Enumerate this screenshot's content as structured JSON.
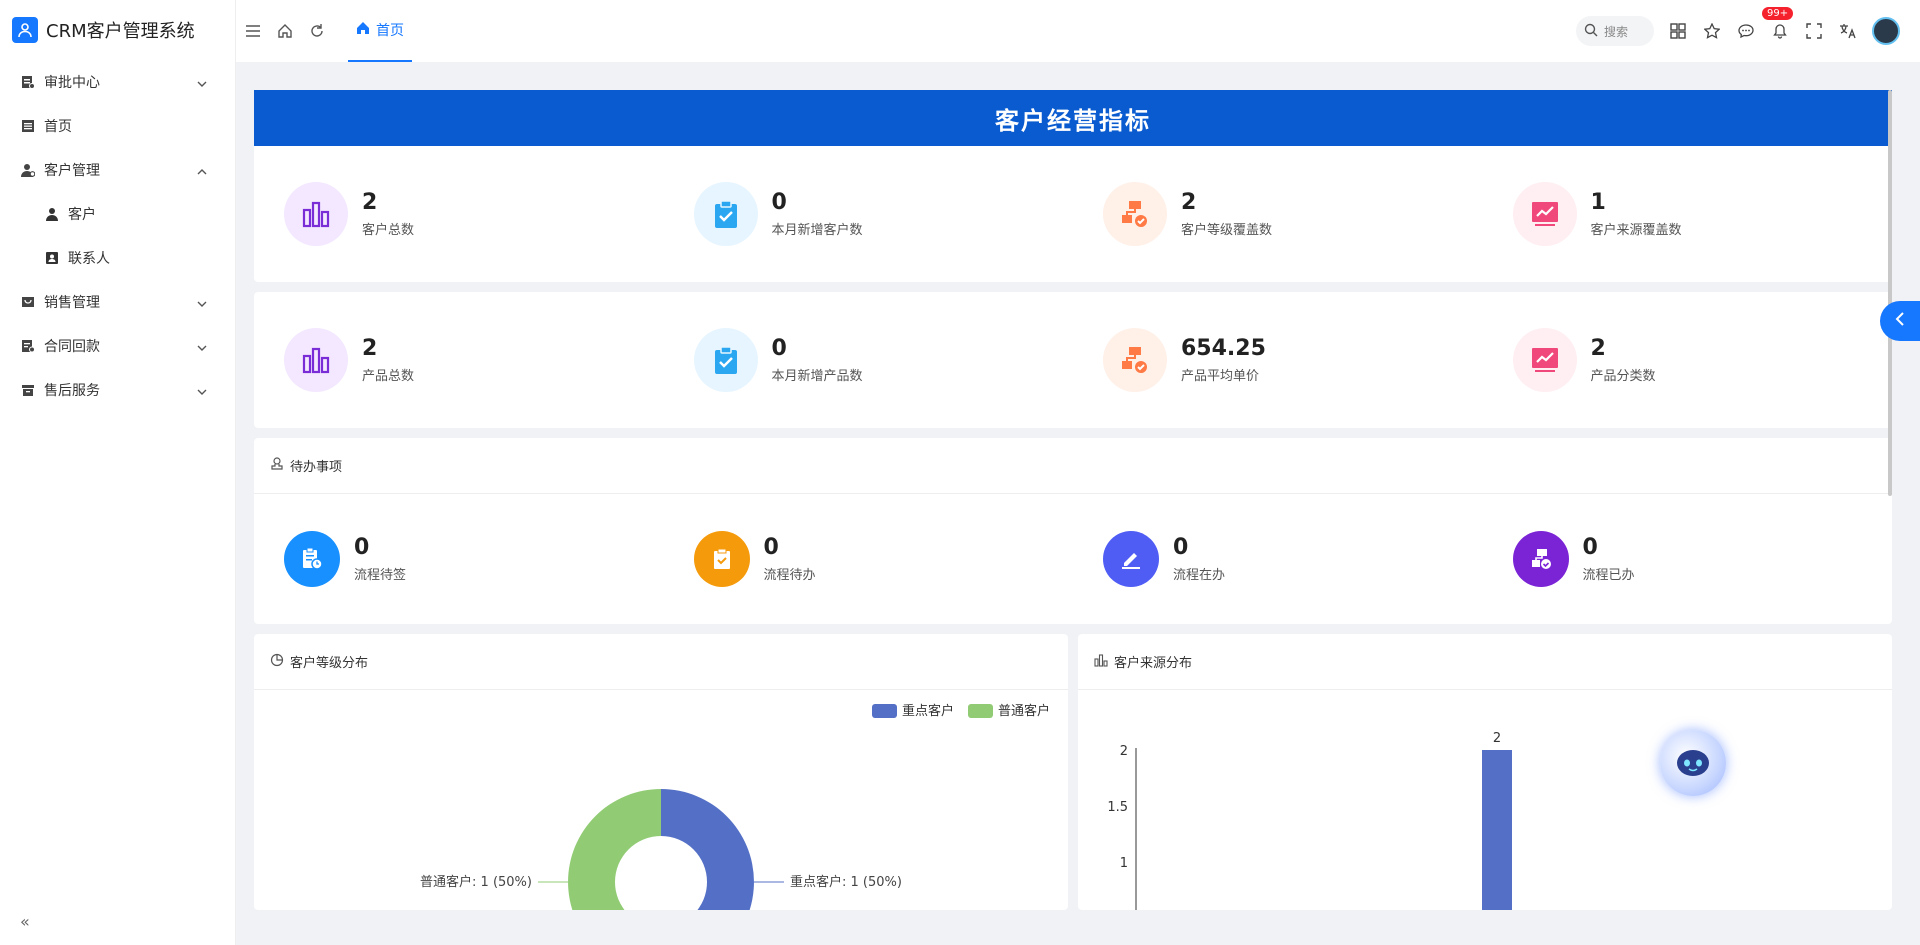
{
  "app": {
    "title": "CRM客户管理系统"
  },
  "sidebar": {
    "items": [
      {
        "label": "审批中心",
        "expandable": true,
        "expanded": false,
        "icon": "approval-icon"
      },
      {
        "label": "首页",
        "expandable": false,
        "icon": "home-doc-icon"
      },
      {
        "label": "客户管理",
        "expandable": true,
        "expanded": true,
        "icon": "customer-mgmt-icon"
      },
      {
        "label": "客户",
        "sub": true,
        "icon": "user-icon"
      },
      {
        "label": "联系人",
        "sub": true,
        "icon": "contact-icon"
      },
      {
        "label": "销售管理",
        "expandable": true,
        "expanded": false,
        "icon": "sales-icon"
      },
      {
        "label": "合同回款",
        "expandable": true,
        "expanded": false,
        "icon": "contract-icon"
      },
      {
        "label": "售后服务",
        "expandable": true,
        "expanded": false,
        "icon": "service-icon"
      }
    ]
  },
  "header": {
    "tab_home": "首页",
    "search_placeholder": "搜索",
    "notification_badge": "99+"
  },
  "banner": {
    "title": "客户经营指标"
  },
  "customer_stats": [
    {
      "value": "2",
      "label": "客户总数",
      "icon": "bar-chart-icon",
      "bg": "#f3e8ff",
      "fg": "#7a2cd6"
    },
    {
      "value": "0",
      "label": "本月新增客户数",
      "icon": "clipboard-check-icon",
      "bg": "#e6f5ff",
      "fg": "#2aa7f0"
    },
    {
      "value": "2",
      "label": "客户等级覆盖数",
      "icon": "flow-check-icon",
      "bg": "#fff0e8",
      "fg": "#ff7a45"
    },
    {
      "value": "1",
      "label": "客户来源覆盖数",
      "icon": "trend-monitor-icon",
      "bg": "#ffeef2",
      "fg": "#f0487a"
    }
  ],
  "product_stats": [
    {
      "value": "2",
      "label": "产品总数",
      "icon": "bar-chart-icon",
      "bg": "#f3e8ff",
      "fg": "#7a2cd6"
    },
    {
      "value": "0",
      "label": "本月新增产品数",
      "icon": "clipboard-check-icon",
      "bg": "#e6f5ff",
      "fg": "#2aa7f0"
    },
    {
      "value": "654.25",
      "label": "产品平均单价",
      "icon": "flow-check-icon",
      "bg": "#fff0e8",
      "fg": "#ff7a45"
    },
    {
      "value": "2",
      "label": "产品分类数",
      "icon": "trend-monitor-icon",
      "bg": "#ffeef2",
      "fg": "#f0487a"
    }
  ],
  "todo": {
    "title": "待办事项",
    "items": [
      {
        "value": "0",
        "label": "流程待签",
        "icon": "clipboard-clock-icon",
        "bg": "#1890ff"
      },
      {
        "value": "0",
        "label": "流程待办",
        "icon": "clipboard-check-icon",
        "bg": "#f59a0b"
      },
      {
        "value": "0",
        "label": "流程在办",
        "icon": "edit-pen-icon",
        "bg": "#4f5df5"
      },
      {
        "value": "0",
        "label": "流程已办",
        "icon": "flow-check-icon",
        "bg": "#7b24d6"
      }
    ]
  },
  "charts_meta": {
    "level_title": "客户等级分布",
    "source_title": "客户来源分布"
  },
  "chart_data": [
    {
      "type": "pie",
      "title": "客户等级分布",
      "categories": [
        "重点客户",
        "普通客户"
      ],
      "values": [
        1,
        1
      ],
      "slice_labels": [
        "重点客户: 1 (50%)",
        "普通客户: 1 (50%)"
      ],
      "colors": [
        "#5470c6",
        "#91cc75"
      ],
      "legend": "top-right",
      "donut": true
    },
    {
      "type": "bar",
      "title": "客户来源分布",
      "values": [
        2
      ],
      "data_labels": [
        "2"
      ],
      "yticks": [
        "2",
        "1.5",
        "1"
      ],
      "ylim": [
        0,
        2
      ],
      "color": "#5470c6"
    }
  ]
}
